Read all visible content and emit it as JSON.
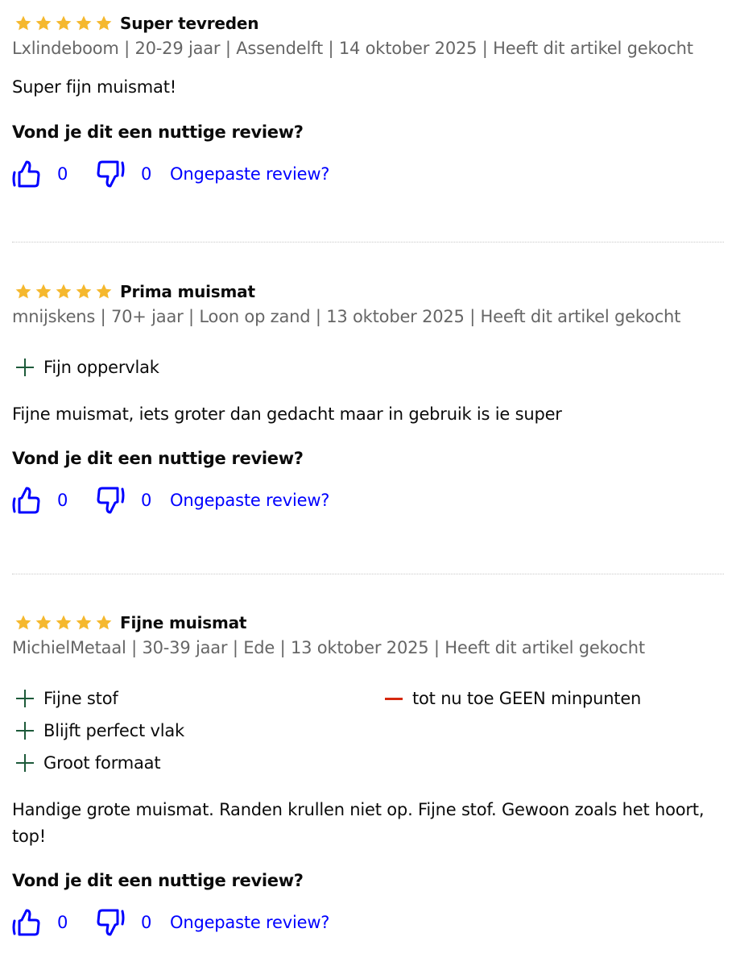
{
  "colors": {
    "star": "#F5B82E",
    "link": "#0000FF",
    "meta": "#666666",
    "plus": "#1D5A3A",
    "minus": "#D6280F"
  },
  "reviews": [
    {
      "rating": 5,
      "title": "Super tevreden",
      "meta": "Lxlindeboom | 20-29 jaar | Assendelft | 14 oktober 2025 | Heeft dit artikel gekocht",
      "pros": [],
      "cons": [],
      "body": "Super fijn muismat!",
      "helpful_question": "Vond je dit een nuttige review?",
      "helpful_count": "0",
      "unhelpful_count": "0",
      "report_label": "Ongepaste review?"
    },
    {
      "rating": 5,
      "title": "Prima muismat",
      "meta": "mnijskens | 70+ jaar | Loon op zand | 13 oktober 2025 | Heeft dit artikel gekocht",
      "pros": [
        "Fijn oppervlak"
      ],
      "cons": [],
      "body": "Fijne muismat, iets groter dan gedacht maar in gebruik is ie super",
      "helpful_question": "Vond je dit een nuttige review?",
      "helpful_count": "0",
      "unhelpful_count": "0",
      "report_label": "Ongepaste review?"
    },
    {
      "rating": 5,
      "title": "Fijne muismat",
      "meta": "MichielMetaal | 30-39 jaar | Ede | 13 oktober 2025 | Heeft dit artikel gekocht",
      "pros": [
        "Fijne stof",
        "Blijft perfect vlak",
        "Groot formaat"
      ],
      "cons": [
        "tot nu toe GEEN minpunten"
      ],
      "body": "Handige grote muismat. Randen krullen niet op. Fijne stof. Gewoon zoals het hoort, top!",
      "helpful_question": "Vond je dit een nuttige review?",
      "helpful_count": "0",
      "unhelpful_count": "0",
      "report_label": "Ongepaste review?"
    }
  ]
}
